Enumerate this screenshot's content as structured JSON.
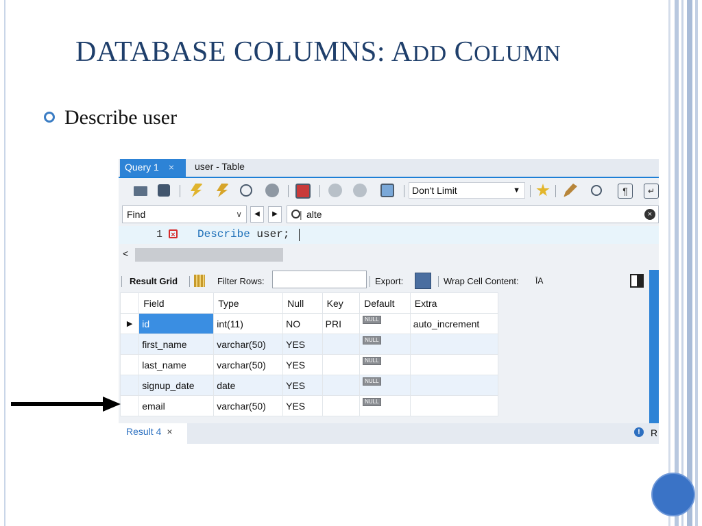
{
  "slide": {
    "title_main": "DATABASE COLUMNS: A",
    "title_sc1": "DD",
    "title_space": " C",
    "title_sc2": "OLUMN",
    "bullet": "Describe user"
  },
  "workbench": {
    "tabs": [
      {
        "label": "Query 1",
        "close": "×"
      },
      {
        "label": "user - Table"
      }
    ],
    "toolbar": {
      "limit_label": "Don't Limit",
      "icons": [
        "open-folder-icon",
        "save-icon",
        "execute-icon",
        "execute-current-icon",
        "explain-icon",
        "stop-icon",
        "toggle-error-icon",
        "commit-icon",
        "rollback-icon",
        "autocommit-icon",
        "limit-dropdown",
        "add-snippet-icon",
        "beautify-icon",
        "find-icon",
        "invisible-chars-icon",
        "wrap-icon"
      ]
    },
    "find_bar": {
      "mode": "Find",
      "search_value": "alte",
      "search_prefix": "|"
    },
    "editor": {
      "line_number": "1",
      "keyword": "Describe",
      "rest": " user;"
    },
    "result_toolbar": {
      "result_grid": "Result Grid",
      "filter_rows": "Filter Rows:",
      "export": "Export:",
      "wrap_cell": "Wrap Cell Content:",
      "wrap_icon_text": "ĪA"
    },
    "grid": {
      "headers": [
        "Field",
        "Type",
        "Null",
        "Key",
        "Default",
        "Extra"
      ],
      "rows": [
        {
          "field": "id",
          "type": "int(11)",
          "null": "NO",
          "key": "PRI",
          "default": "NULL",
          "extra": "auto_increment"
        },
        {
          "field": "first_name",
          "type": "varchar(50)",
          "null": "YES",
          "key": "",
          "default": "NULL",
          "extra": ""
        },
        {
          "field": "last_name",
          "type": "varchar(50)",
          "null": "YES",
          "key": "",
          "default": "NULL",
          "extra": ""
        },
        {
          "field": "signup_date",
          "type": "date",
          "null": "YES",
          "key": "",
          "default": "NULL",
          "extra": ""
        },
        {
          "field": "email",
          "type": "varchar(50)",
          "null": "YES",
          "key": "",
          "default": "NULL",
          "extra": ""
        }
      ]
    },
    "bottom": {
      "result_tab": "Result 4",
      "close": "×",
      "side_letter": "R"
    }
  },
  "colors": {
    "title": "#1f3f6b",
    "accent": "#2d83d6",
    "bullet": "#3b7dc4",
    "circle": "#3a73c6"
  }
}
